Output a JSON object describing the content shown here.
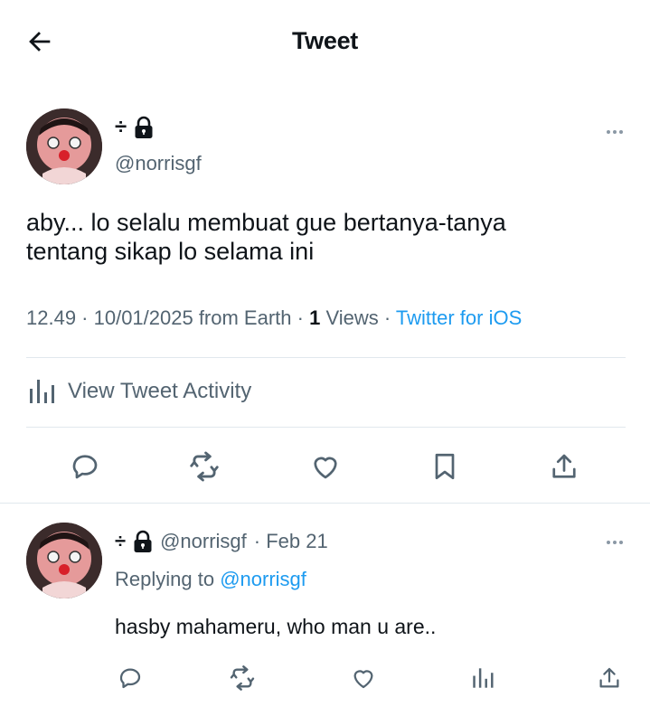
{
  "header": {
    "title": "Tweet",
    "back_icon": "arrow-left-icon"
  },
  "tweet": {
    "author": {
      "name_symbol": "÷",
      "protected_icon": "lock-icon",
      "handle": "@norrisgf",
      "avatar": "avatar-image"
    },
    "text_line1": "aby... lo selalu membuat gue bertanya-tanya",
    "text_line2": "tentang sikap lo selama ini",
    "meta": {
      "time_date": "12.49 · 10/01/2025 from Earth · ",
      "views_count": "1",
      "views_label": " Views · ",
      "source": "Twitter for iOS"
    },
    "activity_label": "View Tweet Activity",
    "actions": [
      "reply-icon",
      "retweet-icon",
      "like-icon",
      "bookmark-icon",
      "share-icon"
    ]
  },
  "reply": {
    "author": {
      "name_symbol": "÷",
      "protected_icon": "lock-icon",
      "handle": "@norrisgf",
      "date": "· Feb 21"
    },
    "replying_prefix": "Replying to ",
    "replying_to": "@norrisgf",
    "text": "hasby mahameru, who man u are..",
    "actions": [
      "reply-icon",
      "retweet-icon",
      "like-icon",
      "analytics-icon",
      "share-icon"
    ]
  },
  "colors": {
    "link": "#1d9bf0",
    "secondary_text": "#536471",
    "divider": "#e1e8ed"
  }
}
